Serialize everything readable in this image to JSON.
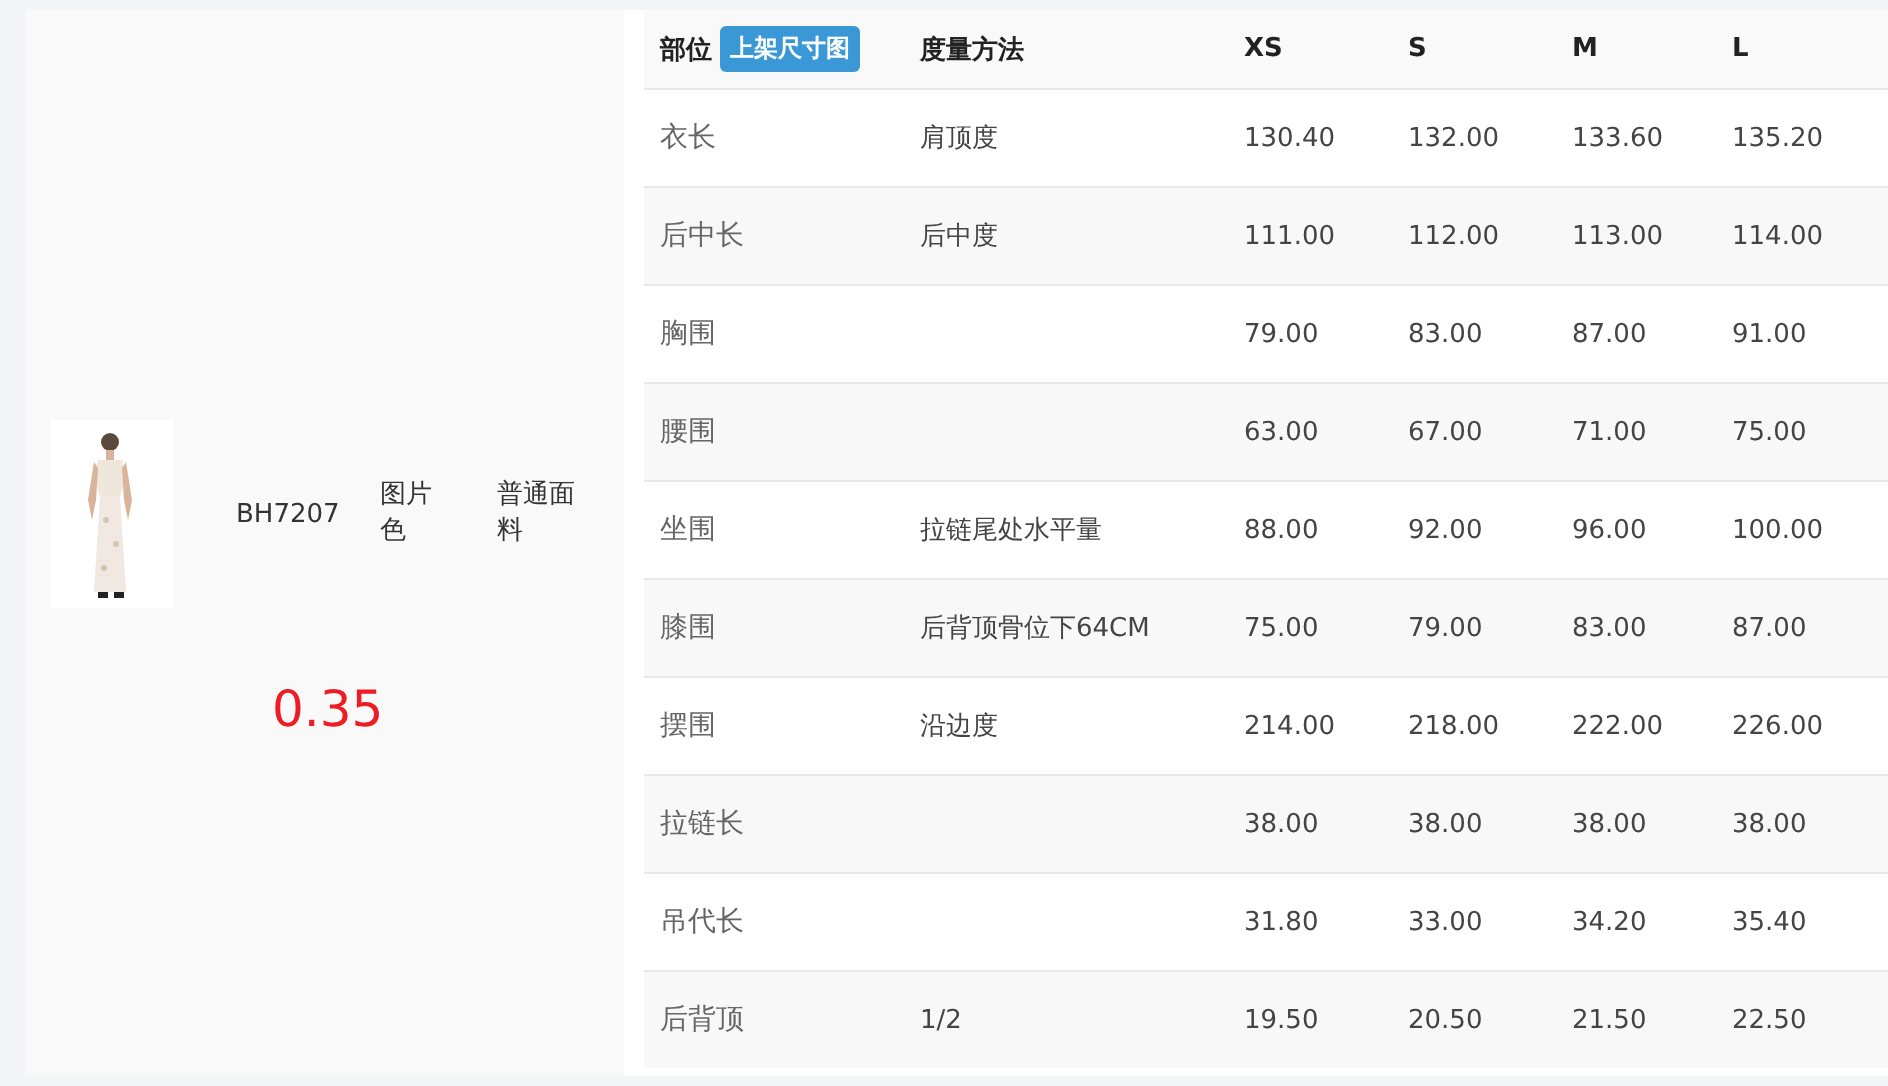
{
  "product": {
    "code": "BH7207",
    "colorway": "图片色",
    "fabric": "普通面料",
    "annotation": "0.35"
  },
  "size_table": {
    "columns": [
      {
        "kind": "part",
        "label": "部位",
        "badge": "上架尺寸图"
      },
      {
        "kind": "text",
        "label": "度量方法"
      },
      {
        "kind": "text",
        "label": "XS"
      },
      {
        "kind": "text",
        "label": "S"
      },
      {
        "kind": "text",
        "label": "M"
      },
      {
        "kind": "text",
        "label": "L"
      }
    ],
    "rows": [
      [
        "衣长",
        "肩顶度",
        "130.40",
        "132.00",
        "133.60",
        "135.20"
      ],
      [
        "后中长",
        "后中度",
        "111.00",
        "112.00",
        "113.00",
        "114.00"
      ],
      [
        "胸围",
        "",
        "79.00",
        "83.00",
        "87.00",
        "91.00"
      ],
      [
        "腰围",
        "",
        "63.00",
        "67.00",
        "71.00",
        "75.00"
      ],
      [
        "坐围",
        "拉链尾处水平量",
        "88.00",
        "92.00",
        "96.00",
        "100.00"
      ],
      [
        "膝围",
        "后背顶骨位下64CM",
        "75.00",
        "79.00",
        "83.00",
        "87.00"
      ],
      [
        "摆围",
        "沿边度",
        "214.00",
        "218.00",
        "222.00",
        "226.00"
      ],
      [
        "拉链长",
        "",
        "38.00",
        "38.00",
        "38.00",
        "38.00"
      ],
      [
        "吊代长",
        "",
        "31.80",
        "33.00",
        "34.20",
        "35.40"
      ],
      [
        "后背顶",
        "1/2",
        "19.50",
        "20.50",
        "21.50",
        "22.50"
      ]
    ]
  }
}
